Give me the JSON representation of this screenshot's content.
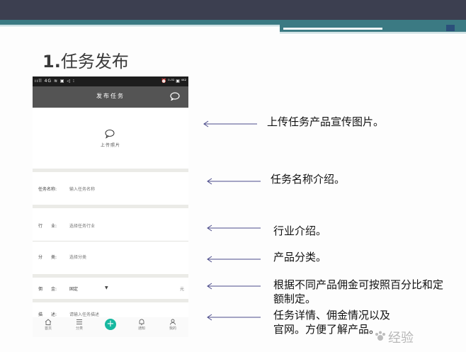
{
  "slide": {
    "title_number": "1.",
    "title_text": "任务发布"
  },
  "phone": {
    "statusbar": {
      "left": "ııll 4G ≋ ▣ ◁ ⁝",
      "right": "⏰ ⁰·⁰¹ ▣ ⁴⁴²"
    },
    "topbar_title": "发布任务",
    "upload_label": "上传照片",
    "fields": {
      "name_label": "任务名称:",
      "name_placeholder": "输入任务名称",
      "industry_label": "行　　业:",
      "industry_placeholder": "选择任务行业",
      "category_label": "分　　类:",
      "category_placeholder": "选择分类",
      "commission_label": "佣　　金:",
      "commission_value": "固定",
      "commission_unit": "元",
      "desc_label": "描　　述:",
      "desc_placeholder": "请输入任务描述"
    },
    "tabbar": {
      "home": "首页",
      "category": "分类",
      "notice": "通知",
      "mine": "我的"
    }
  },
  "notes": {
    "upload": "上传任务产品宣传图片。",
    "name": "任务名称介绍。",
    "industry": "行业介绍。",
    "category": "产品分类。",
    "commission_line1": "根据不同产品佣金可按照百分比和定",
    "commission_line2": "额制定。",
    "desc_line1": "任务详情、佣金情况以及",
    "desc_line2": "官网。方便了解产品。"
  },
  "watermark": "经验",
  "colors": {
    "header_dark": "#3c3f50",
    "header_teal": "#3b7a83",
    "app_bar": "#545454",
    "accent": "#17b8a0",
    "arrow": "#4a4a8a"
  }
}
